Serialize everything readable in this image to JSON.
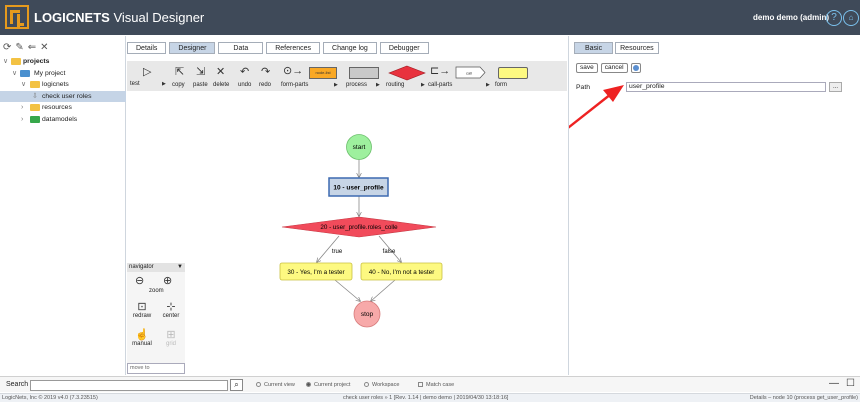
{
  "header": {
    "brand_bold": "LOGICNETS",
    "brand_rest": " Visual Designer",
    "user": "demo demo (admin)",
    "help_icon": "?",
    "home_icon": "home"
  },
  "left_toolbar": {
    "icons": [
      "refresh-icon",
      "edit-icon",
      "import-icon",
      "delete-icon"
    ]
  },
  "tree": {
    "items": [
      {
        "label": "projects",
        "level": 0,
        "folder": "yellow",
        "expanded": true,
        "bold": true
      },
      {
        "label": "My project",
        "level": 1,
        "folder": "blue",
        "expanded": true
      },
      {
        "label": "logicnets",
        "level": 2,
        "folder": "yellow",
        "expanded": true
      },
      {
        "label": "check user roles",
        "level": 3,
        "folder": "none",
        "selected": true
      },
      {
        "label": "resources",
        "level": 2,
        "folder": "yellow",
        "expanded": false
      },
      {
        "label": "datamodels",
        "level": 2,
        "folder": "green",
        "expanded": false
      }
    ]
  },
  "tabs": [
    "Details",
    "Designer",
    "Data",
    "References",
    "Change log",
    "Debugger"
  ],
  "active_tab": "Designer",
  "palette": {
    "test": "test",
    "copy": "copy",
    "paste": "paste",
    "delete": "delete",
    "undo": "undo",
    "redo": "redo",
    "form_parts": "form-parts",
    "process": "process",
    "routing": "routing",
    "call_parts": "call-parts",
    "form": "form",
    "node_form_text": "node-list",
    "call_box_text": "call"
  },
  "flow": {
    "start": "start",
    "node10": "10 - user_profile",
    "node20": "20 - user_profile.roles_colle",
    "edge_true": "true",
    "edge_false": "false",
    "node30": "30 - Yes, I'm a tester",
    "node40": "40 - No, I'm not a tester",
    "stop": "stop"
  },
  "navigator": {
    "title": "navigator",
    "zoom": "zoom",
    "redraw": "redraw",
    "center": "center",
    "manual": "manual",
    "grid": "grid",
    "move_to_placeholder": "move to"
  },
  "right_panel": {
    "tabs": [
      "Basic",
      "Resources"
    ],
    "active_tab": "Basic",
    "save": "save",
    "cancel": "cancel",
    "path_label": "Path",
    "path_value": "user_profile",
    "browse": "..."
  },
  "search": {
    "label": "Search",
    "value": "",
    "options": [
      "Current view",
      "Current project",
      "Workspace"
    ],
    "selected": "Current project",
    "match_case": "Match case"
  },
  "status": {
    "left": "LogicNets, Inc © 2019 v4.0 (7.3.23515)",
    "center": "check user roles » 1 [Rev. 1.14 | demo demo | 2019/04/30 13:18:16]",
    "right": "Details – node 10 (process get_user_profile)"
  },
  "colors": {
    "header_bg": "#3f4a59",
    "logo": "#e59a1d",
    "start_fill": "#9ef09e",
    "process_fill": "#c7d5e6",
    "routing_fill": "#f14b5b",
    "form_fill": "#fdf981",
    "stop_fill": "#f7a9a9",
    "annotation_arrow": "#ee2222"
  }
}
